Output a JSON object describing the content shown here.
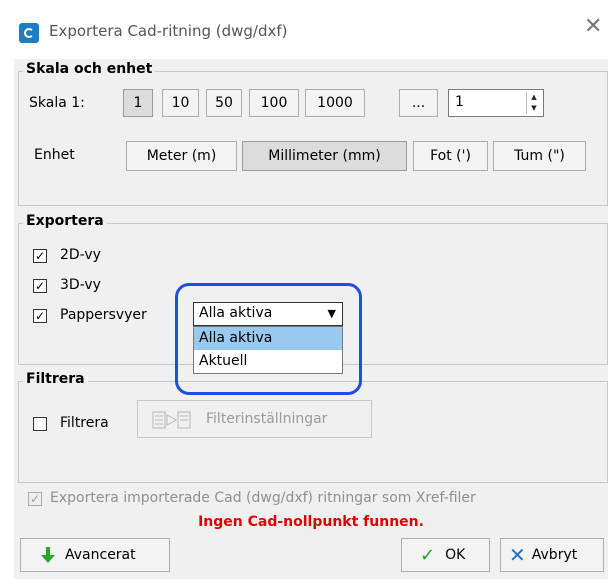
{
  "window": {
    "title": "Exportera Cad-ritning (dwg/dxf)",
    "close_icon": "close-icon",
    "app_icon": "cad-export-icon"
  },
  "scale_group": {
    "title": "Skala och enhet",
    "scale_label": "Skala 1:",
    "scale_buttons": [
      "1",
      "10",
      "50",
      "100",
      "1000",
      "..."
    ],
    "scale_value": "1",
    "unit_label": "Enhet",
    "unit_buttons": [
      "Meter (m)",
      "Millimeter (mm)",
      "Fot (')",
      "Tum (\")"
    ],
    "selected_unit": "Millimeter (mm)"
  },
  "export_group": {
    "title": "Exportera",
    "opt_2d": "2D-vy",
    "opt_3d": "3D-vy",
    "opt_paper": "Pappersvyer",
    "paper_selected": "Alla aktiva",
    "paper_options": [
      "Alla aktiva",
      "Aktuell"
    ]
  },
  "filter_group": {
    "title": "Filtrera",
    "filter_checkbox": "Filtrera",
    "filter_settings": "Filterinställningar"
  },
  "xref_option": "Exportera importerade Cad (dwg/dxf) ritningar som Xref-filer",
  "warning": "Ingen Cad-nollpunkt funnen.",
  "buttons": {
    "advanced": "Avancerat",
    "ok": "OK",
    "cancel": "Avbryt"
  },
  "colors": {
    "warning": "#e00000",
    "highlight": "#1f4fe0",
    "selection": "#99c9ef",
    "ok_check": "#2a9d2a",
    "cancel_x": "#1e6fc8",
    "advanced_arrow": "#2aa82a"
  }
}
